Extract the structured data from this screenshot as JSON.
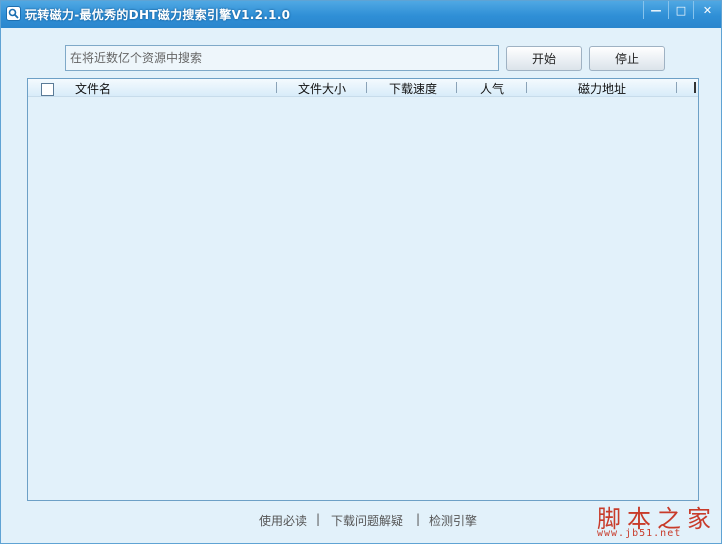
{
  "window": {
    "title": "玩转磁力-最优秀的DHT磁力搜索引擎V1.2.1.0",
    "controls": {
      "minimize": "—",
      "maximize": "□",
      "close": "✕"
    }
  },
  "search": {
    "placeholder": "在将近数亿个资源中搜索",
    "value": "",
    "start_label": "开始",
    "stop_label": "停止"
  },
  "table": {
    "select_all_checked": false,
    "columns": [
      "文件名",
      "文件大小",
      "下载速度",
      "人气",
      "磁力地址"
    ],
    "rows": []
  },
  "footer": {
    "links": [
      "使用必读",
      "下载问题解疑",
      "检测引擎"
    ],
    "separator": "|"
  },
  "watermark": {
    "text": "脚本之家",
    "url": "www.jb51.net"
  },
  "colors": {
    "titlebar": "#2f8fd6",
    "window_bg": "#e2f1fa",
    "list_border": "#6da0c6",
    "watermark": "#c83b2a"
  }
}
